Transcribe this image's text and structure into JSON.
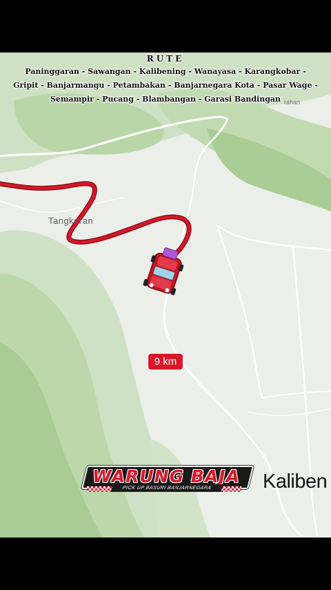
{
  "route": {
    "title": "RUTE",
    "stops_line1": "Paninggaran - Sawangan - Kalibening - Wanayasa - Karangkobar -",
    "stops_line2": "Gripit - Banjarmangu - Petambakan - Banjarnegara Kota - Pasar Wage -",
    "stops_line3": "Semampir - Pucang - Blambangan - Garasi Bandingan"
  },
  "map": {
    "place_labels": {
      "tangkeran": "Tangkeran",
      "kalibening": "Kaliben",
      "top_right": "rahan"
    },
    "distance_badge": "9 km",
    "route_color": "#d8182a",
    "vehicle_icon": "red-pickup-car-icon"
  },
  "logo": {
    "name": "WARUNG BAJA",
    "tagline": "PICK UP BASURI BANJARNEGARA"
  }
}
